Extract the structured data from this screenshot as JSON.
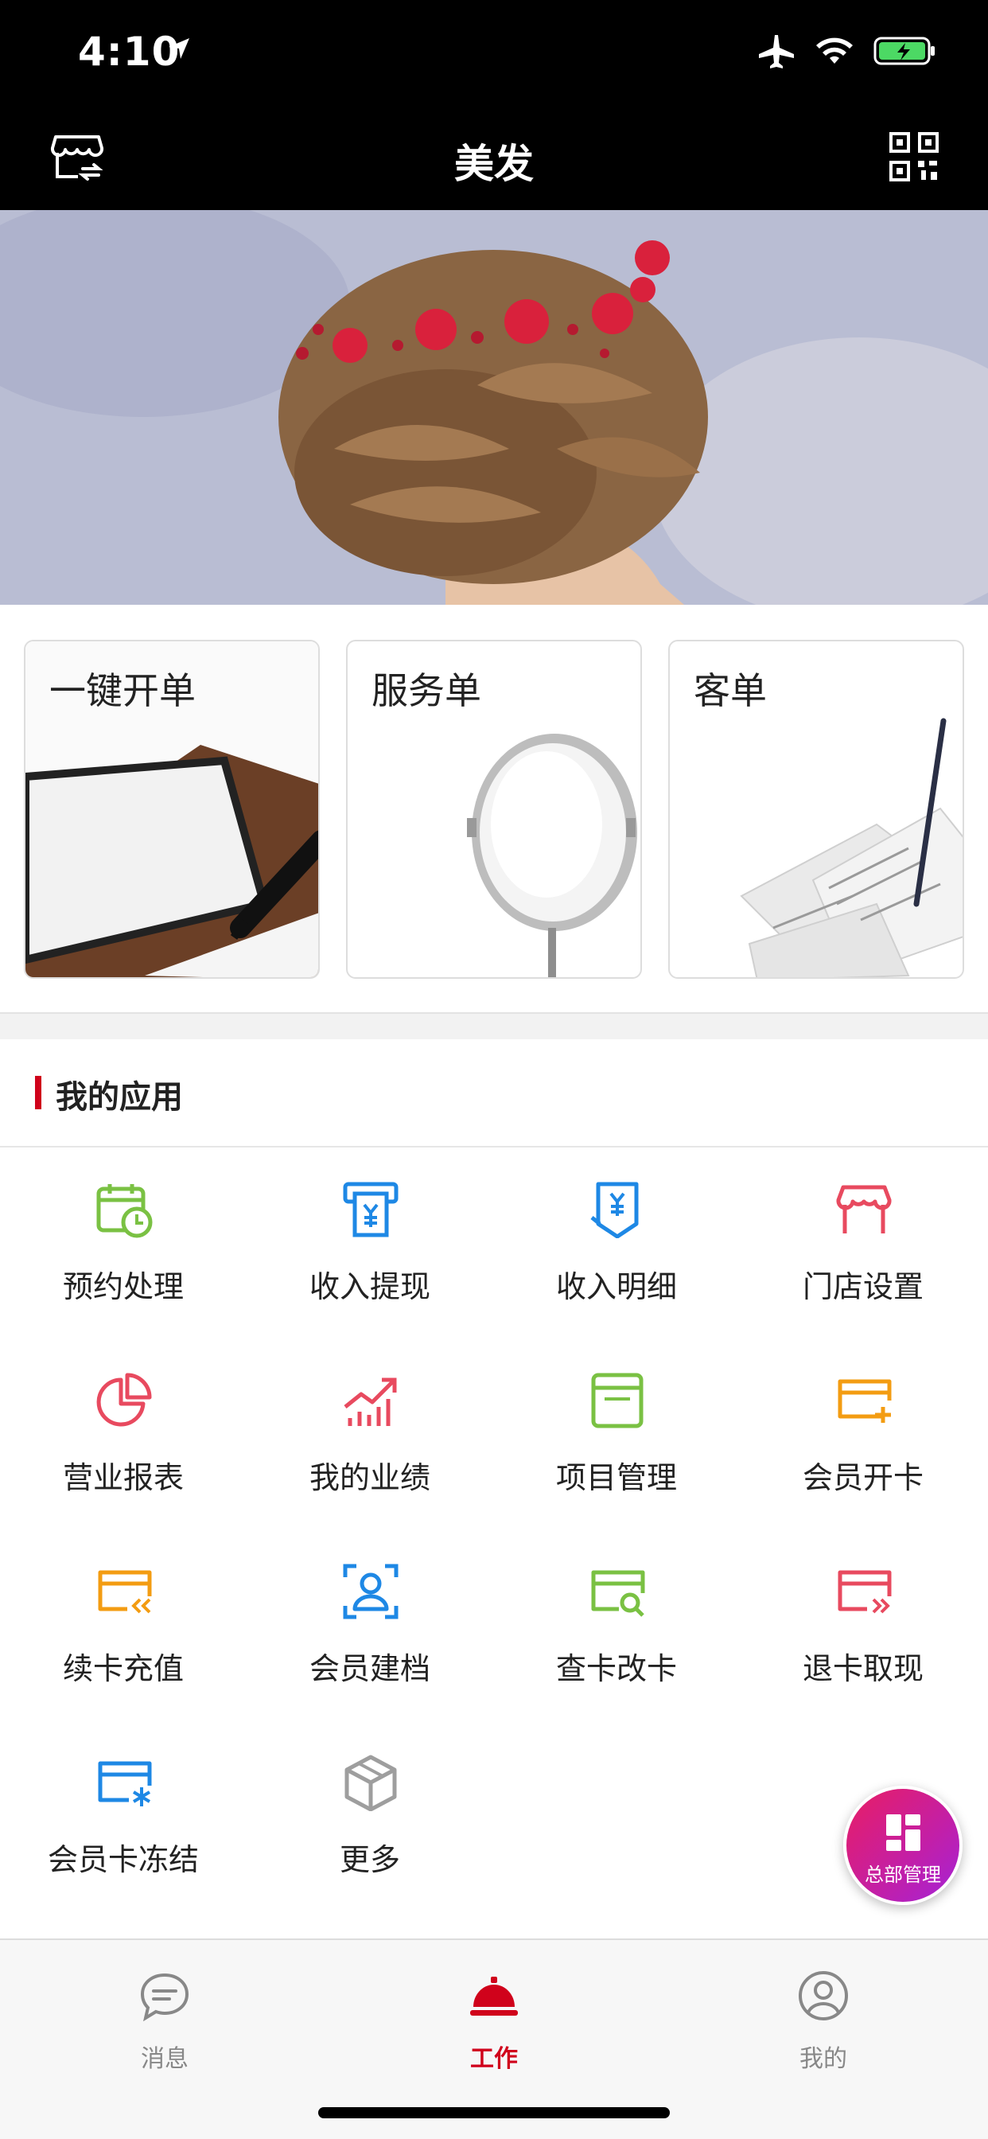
{
  "status_bar": {
    "time": "4:10"
  },
  "nav": {
    "title": "美发",
    "left_icon": "store-switch-icon",
    "right_icon": "qr-code-icon"
  },
  "quick_cards": [
    {
      "label": "一键开单"
    },
    {
      "label": "服务单"
    },
    {
      "label": "客单"
    }
  ],
  "section": {
    "title": "我的应用"
  },
  "apps": [
    {
      "label": "预约处理",
      "icon": "calendar-clock-icon",
      "color": "#7ac143"
    },
    {
      "label": "收入提现",
      "icon": "cash-withdraw-icon",
      "color": "#1e88e5"
    },
    {
      "label": "收入明细",
      "icon": "income-detail-icon",
      "color": "#1e88e5"
    },
    {
      "label": "门店设置",
      "icon": "store-icon",
      "color": "#e84a5f"
    },
    {
      "label": "营业报表",
      "icon": "pie-chart-icon",
      "color": "#e84a5f"
    },
    {
      "label": "我的业绩",
      "icon": "trend-chart-icon",
      "color": "#e84a5f"
    },
    {
      "label": "项目管理",
      "icon": "window-icon",
      "color": "#7ac143"
    },
    {
      "label": "会员开卡",
      "icon": "card-add-icon",
      "color": "#f39c12"
    },
    {
      "label": "续卡充值",
      "icon": "card-recharge-icon",
      "color": "#f39c12"
    },
    {
      "label": "会员建档",
      "icon": "member-profile-icon",
      "color": "#1e88e5"
    },
    {
      "label": "查卡改卡",
      "icon": "card-search-icon",
      "color": "#7ac143"
    },
    {
      "label": "退卡取现",
      "icon": "card-refund-icon",
      "color": "#e84a5f"
    },
    {
      "label": "会员卡冻结",
      "icon": "card-freeze-icon",
      "color": "#1e88e5"
    },
    {
      "label": "更多",
      "icon": "cube-icon",
      "color": "#9e9e9e"
    }
  ],
  "fab": {
    "label": "总部管理"
  },
  "tabs": [
    {
      "label": "消息",
      "icon": "chat-bubble-icon"
    },
    {
      "label": "工作",
      "icon": "service-bell-icon"
    },
    {
      "label": "我的",
      "icon": "user-profile-icon"
    }
  ],
  "colors": {
    "accent": "#d0021b",
    "nav_bg": "#000000",
    "tab_inactive": "#888888"
  }
}
